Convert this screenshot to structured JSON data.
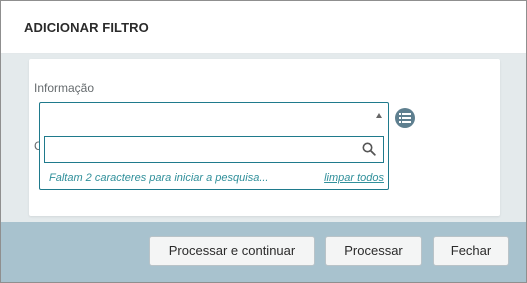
{
  "dialog": {
    "title": "ADICIONAR FILTRO"
  },
  "form": {
    "field_label": "Informação",
    "second_label_partial": "C",
    "search": {
      "value": "",
      "placeholder": ""
    },
    "hint": "Faltam 2 caracteres para iniciar a pesquisa...",
    "clear_link": "limpar todos"
  },
  "icons": {
    "caret": "caret-up-icon",
    "search": "search-icon",
    "list": "list-icon"
  },
  "footer": {
    "buttons": [
      {
        "label": "Processar e continuar"
      },
      {
        "label": "Processar"
      },
      {
        "label": "Fechar"
      }
    ]
  },
  "colors": {
    "accent": "#1f7a8c",
    "hint": "#2f8f9a",
    "footer_bg": "#a8c2ce",
    "body_bg": "#e4eaec",
    "icon_button": "#5e7f8f"
  }
}
